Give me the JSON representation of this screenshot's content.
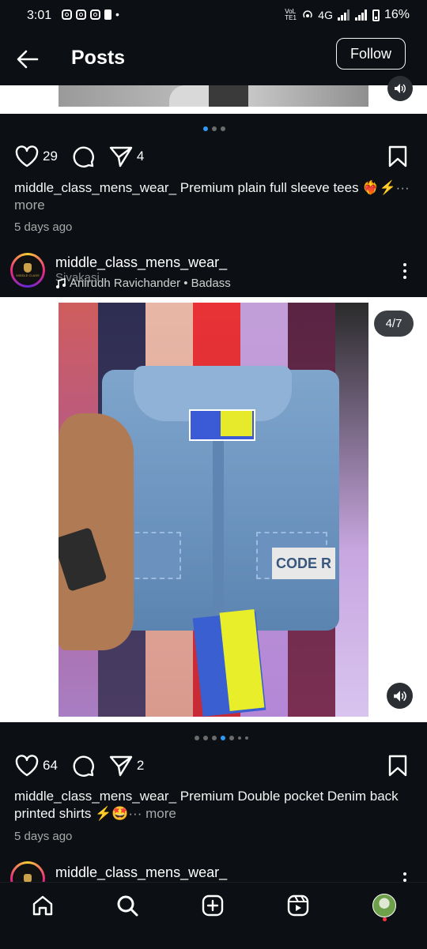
{
  "status_bar": {
    "time": "3:01",
    "network": "4G",
    "volte_label": "VoLTE1",
    "battery": "16%",
    "notification_dot": "•"
  },
  "header": {
    "title": "Posts",
    "follow_label": "Follow"
  },
  "post1": {
    "likes": "29",
    "shares": "4",
    "caption_text": "middle_class_mens_wear_ Premium plain  full sleeve tees ❤️‍🔥⚡",
    "more_label": "··· more",
    "time_ago": "5 days ago",
    "carousel_dots": 3,
    "carousel_active_index": 0
  },
  "post2": {
    "username": "middle_class_mens_wear_",
    "location": "Sivakasi",
    "music": "Anirudh Ravichander • Badass",
    "avatar_text": "MIDDLE CLASS",
    "counter": "4/7",
    "patch_text": "CODE R",
    "likes": "64",
    "shares": "2",
    "caption_text": "middle_class_mens_wear_ Premium Double pocket Denim back printed shirts ⚡🤩",
    "more_label": "··· more",
    "time_ago": "5 days ago",
    "carousel_dots": 7,
    "carousel_active_index": 3
  },
  "post3": {
    "username": "middle_class_mens_wear_"
  },
  "icons": {
    "back": "arrow-left-icon",
    "like": "heart-icon",
    "comment": "comment-icon",
    "share": "send-icon",
    "save": "bookmark-icon",
    "mute": "speaker-icon",
    "more": "kebab-icon",
    "music": "music-note-icon"
  },
  "bottom_nav": {
    "items": [
      "home",
      "search",
      "create",
      "reels",
      "profile"
    ]
  },
  "colors": {
    "background": "#0c1014",
    "accent": "#2f9af5",
    "muted_text": "#a8a8a8",
    "notification": "#ff3040"
  }
}
